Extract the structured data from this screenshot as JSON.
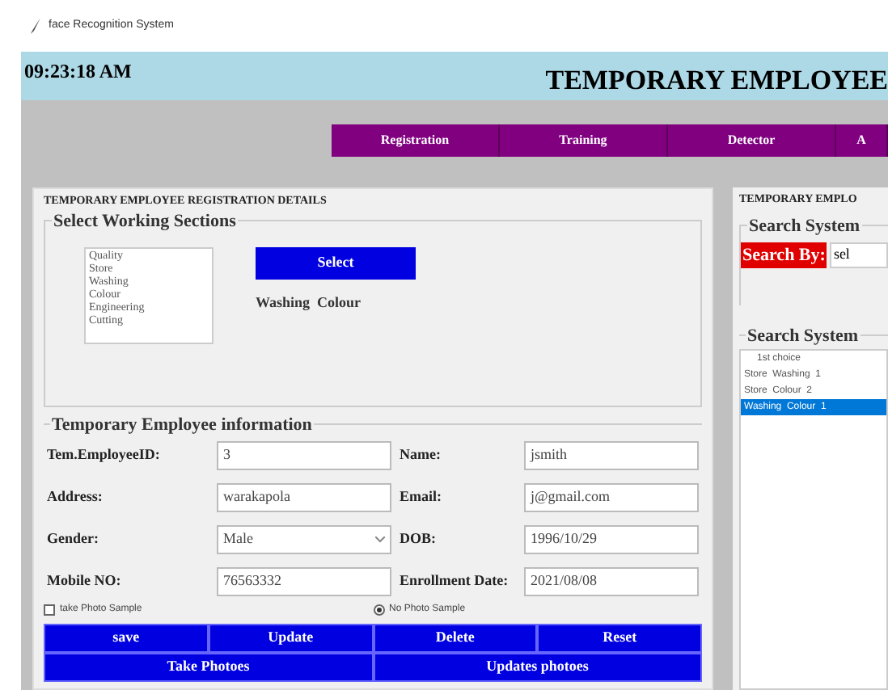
{
  "window": {
    "title": "face Recognition System"
  },
  "header": {
    "clock": "09:23:18 AM",
    "title": "TEMPORARY EMPLOYEE"
  },
  "nav": [
    {
      "label": "Registration",
      "selected": false
    },
    {
      "label": "Training",
      "selected": false
    },
    {
      "label": "Detector",
      "selected": false
    },
    {
      "label": "A",
      "selected": false
    }
  ],
  "registration": {
    "title": "TEMPORARY EMPLOYEE REGISTRATION DETAILS",
    "sections": {
      "title": "Select Working Sections",
      "options": [
        "Quality",
        "Store",
        "Washing",
        "Colour",
        "Engineering",
        "Cutting"
      ],
      "button": "Select",
      "chosen": "Washing  Colour"
    },
    "info": {
      "title": "Temporary Employee information",
      "fields": [
        {
          "label": "Tem.EmployeeID:",
          "value": "3",
          "kind": "text"
        },
        {
          "label": "Name:",
          "value": "jsmith",
          "kind": "text"
        },
        {
          "label": "Address:",
          "value": "warakapola",
          "kind": "text"
        },
        {
          "label": "Email:",
          "value": "j@gmail.com",
          "kind": "text"
        },
        {
          "label": "Gender:",
          "value": "Male",
          "kind": "select"
        },
        {
          "label": "DOB:",
          "value": "1996/10/29",
          "kind": "text"
        },
        {
          "label": "Mobile NO:",
          "value": "76563332",
          "kind": "text"
        },
        {
          "label": "Enrollment Date:",
          "value": "2021/08/08",
          "kind": "text"
        }
      ],
      "photo_options": [
        {
          "label": "take Photo Sample",
          "kind": "checkbox",
          "checked": false
        },
        {
          "label": "No Photo Sample",
          "kind": "radio",
          "checked": true
        }
      ],
      "buttons": [
        "save",
        "Update",
        "Delete",
        "Reset"
      ],
      "photo_buttons": [
        "Take Photoes",
        "Updates photoes"
      ]
    }
  },
  "search_panel": {
    "title": "TEMPORARY EMPLO",
    "search": {
      "title": "Search System",
      "label": "Search By:",
      "value": "sel"
    },
    "results": {
      "title": "Search System",
      "heading": "1st choice",
      "rows": [
        {
          "text": "Store  Washing  1",
          "selected": false
        },
        {
          "text": "Store  Colour  2",
          "selected": false
        },
        {
          "text": "Washing  Colour  1",
          "selected": true
        }
      ]
    }
  }
}
